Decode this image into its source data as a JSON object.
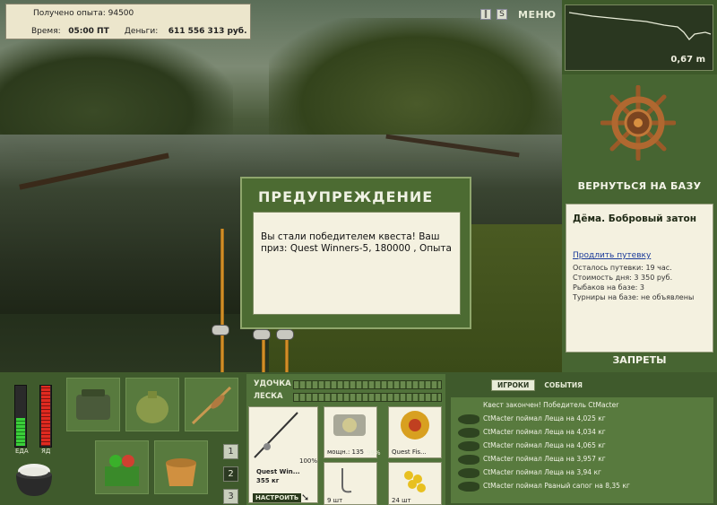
{
  "stats": {
    "exp_label": "Получено опыта:",
    "exp_value": "94500",
    "time_label": "Время:",
    "time_value": "05:00 ПТ",
    "money_label": "Деньги:",
    "money_value": "611 556 313 руб."
  },
  "top": {
    "pause_icon": "pause-icon",
    "sound_icon": "sound-icon",
    "menu_label": "МЕНЮ"
  },
  "depth": {
    "value": "0,67 m"
  },
  "right_panel": {
    "return_label": "ВЕРНУТЬСЯ НА БАЗУ",
    "base_name": "Дёма. Бобровый затон",
    "extend_link": "Продлить путевку",
    "lines": [
      "Осталось путевки: 19 час.",
      "Стоимость дня: 3 350 руб.",
      "Рыбаков на базе: 3",
      "Турниры на базе: не объявлены"
    ],
    "bans_label": "ЗАПРЕТЫ"
  },
  "dialog": {
    "title": "ПРЕДУПРЕЖДЕНИЕ",
    "message": "Вы стали победителем квеста! Ваш приз: Quest Winners-5, 180000 , Опыта"
  },
  "meters": {
    "food_label": "ЕДА",
    "food_level": 0.45,
    "fatigue_label": "ЯД",
    "fatigue_level": 1.0
  },
  "inventory_pages": [
    "1",
    "2",
    "3"
  ],
  "gear": {
    "rod_label": "УДОЧКА",
    "line_label": "ЛЕСКА",
    "rod_name": "Quest Win...",
    "rod_weight": "355 кг",
    "rod_percent": "100%",
    "setup_label": "НАСТРОИТЬ",
    "reel_power": "мощн.: 135",
    "reel_percent": "99%",
    "line_name": "Quest Fis...",
    "hook_count": "9 шт",
    "bait_count": "24 шт"
  },
  "events": {
    "tab_players": "ИГРОКИ",
    "tab_events": "СОБЫТИЯ",
    "header": "Квест закончен! Победитель CtMacter",
    "items": [
      "CtMacter поймал Леща на 4,025 кг",
      "CtMacter поймал Леща на 4,034 кг",
      "CtMacter поймал Леща на 4,065 кг",
      "CtMacter поймал Леща на 3,957 кг",
      "CtMacter поймал Леща на 3,94 кг",
      "CtMacter поймал Рваный сапог на 8,35 кг"
    ]
  }
}
